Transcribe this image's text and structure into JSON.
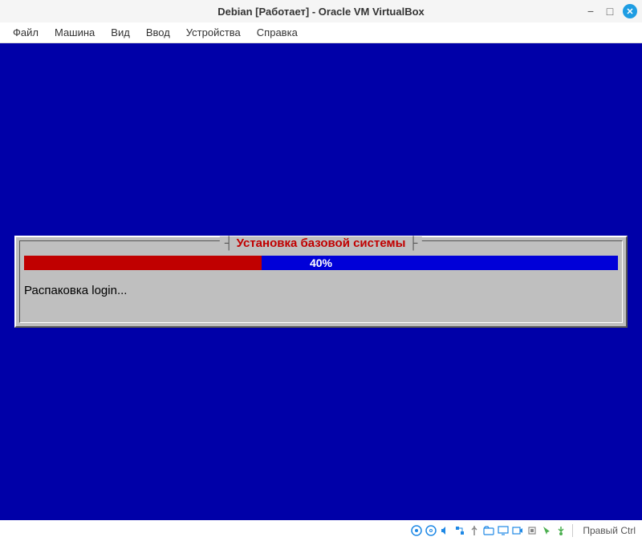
{
  "window": {
    "title": "Debian [Работает] - Oracle VM VirtualBox"
  },
  "menubar": {
    "items": [
      "Файл",
      "Машина",
      "Вид",
      "Ввод",
      "Устройства",
      "Справка"
    ]
  },
  "installer": {
    "title": "Установка базовой системы",
    "progress_percent": 40,
    "progress_label": "40%",
    "status": "Распаковка login..."
  },
  "statusbar": {
    "host_key": "Правый Ctrl"
  }
}
